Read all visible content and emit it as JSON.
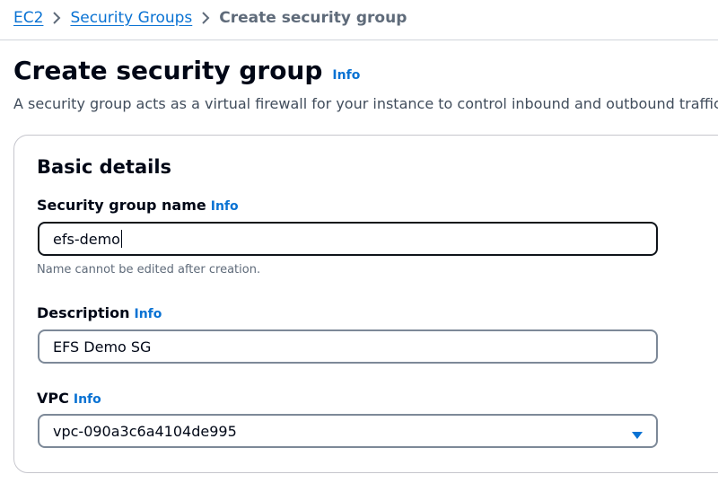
{
  "breadcrumb": {
    "items": [
      {
        "label": "EC2"
      },
      {
        "label": "Security Groups"
      },
      {
        "label": "Create security group"
      }
    ]
  },
  "header": {
    "title": "Create security group",
    "info": "Info",
    "description": "A security group acts as a virtual firewall for your instance to control inbound and outbound traffic."
  },
  "basic_details": {
    "title": "Basic details",
    "name_field": {
      "label": "Security group name",
      "info": "Info",
      "value": "efs-demo",
      "hint": "Name cannot be edited after creation."
    },
    "description_field": {
      "label": "Description",
      "info": "Info",
      "value": "EFS Demo SG"
    },
    "vpc_field": {
      "label": "VPC",
      "info": "Info",
      "value": "vpc-090a3c6a4104de995"
    }
  },
  "colors": {
    "link": "#0972d3",
    "text": "#000716",
    "muted": "#5f6b7a",
    "border": "#7d8998"
  },
  "icons": {
    "separator": "chevron-right-icon",
    "dropdown": "caret-down-icon"
  }
}
